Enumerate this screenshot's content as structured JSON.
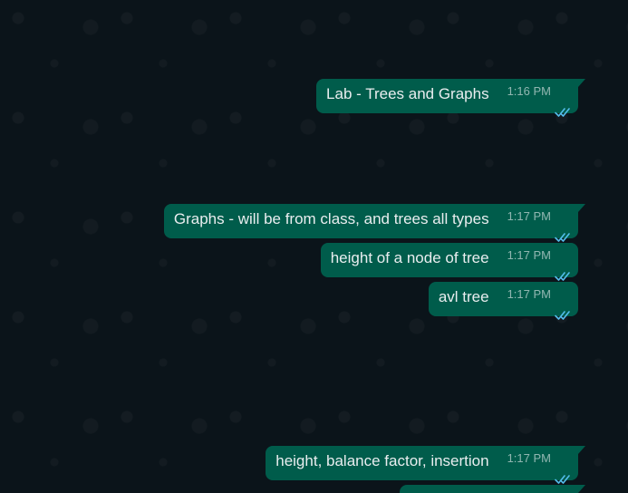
{
  "messages": [
    {
      "text": "Lab - Trees and Graphs",
      "time": "1:16 PM",
      "status": "read-double-tick-icon"
    },
    {
      "text": "Graphs - will be from class, and trees all types",
      "time": "1:17 PM",
      "status": "read-double-tick-icon"
    },
    {
      "text": "height of a node of tree",
      "time": "1:17 PM",
      "status": "read-double-tick-icon"
    },
    {
      "text": "avl tree",
      "time": "1:17 PM",
      "status": "read-double-tick-icon"
    },
    {
      "text": "height, balance factor, insertion",
      "time": "1:17 PM",
      "status": "read-double-tick-icon"
    }
  ],
  "colors": {
    "background": "#0b141a",
    "outgoing_bubble": "#005c4b",
    "text": "#e9edef",
    "read_ticks": "#53bdeb"
  }
}
